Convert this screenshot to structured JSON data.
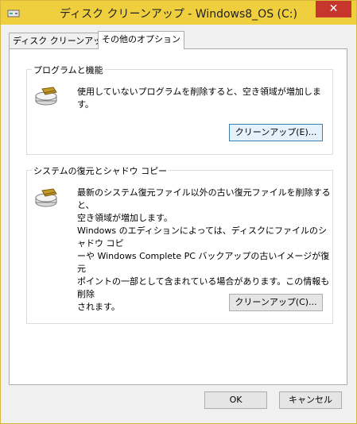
{
  "window": {
    "title": "ディスク クリーンアップ - Windows8_OS (C:)",
    "close_label": "✕"
  },
  "tabs": [
    {
      "label": "ディスク クリーンアップ"
    },
    {
      "label": "その他のオプション"
    }
  ],
  "programs": {
    "title": "プログラムと機能",
    "description": "使用していないプログラムを削除すると、空き領域が増加します。",
    "button": "クリーンアップ(E)..."
  },
  "restore": {
    "title": "システムの復元とシャドウ コピー",
    "desc_line1": "最新のシステム復元ファイル以外の古い復元ファイルを削除すると、",
    "desc_line2": "空き領域が増加します。",
    "note_line1": "Windows のエディションによっては、ディスクにファイルのシャドウ コピ",
    "note_line2": "ーや Windows Complete PC バックアップの古いイメージが復元",
    "note_line3": "ポイントの一部として含まれている場合があります。この情報も削除",
    "note_line4": "されます。",
    "button": "クリーンアップ(C)..."
  },
  "footer": {
    "ok": "OK",
    "cancel": "キャンセル"
  }
}
